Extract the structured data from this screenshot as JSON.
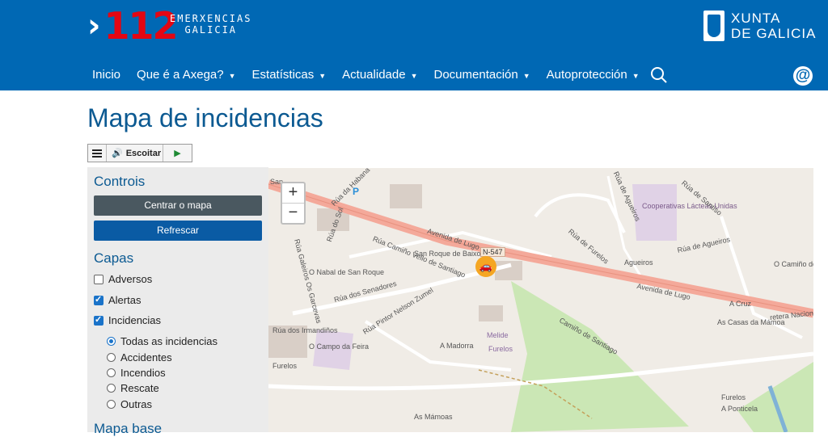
{
  "header": {
    "logo_number": "112",
    "logo_line1": "EMERXENCIAS",
    "logo_line2": "GALICIA",
    "xunta_line1": "XUNTA",
    "xunta_line2": "DE GALICIA",
    "background": "#0068b4"
  },
  "nav": {
    "items": [
      {
        "label": "Inicio",
        "dropdown": false
      },
      {
        "label": "Que é a Axega?",
        "dropdown": true
      },
      {
        "label": "Estatísticas",
        "dropdown": true
      },
      {
        "label": "Actualidade",
        "dropdown": true
      },
      {
        "label": "Documentación",
        "dropdown": true
      },
      {
        "label": "Autoprotección",
        "dropdown": true
      }
    ],
    "search_icon": "search-icon",
    "contact_icon": "at-icon"
  },
  "page": {
    "title": "Mapa de incidencias"
  },
  "player": {
    "menu_icon": "menu-icon",
    "listen_label": "Escoitar",
    "play_icon": "play-icon"
  },
  "sidebar": {
    "controls_heading": "Controis",
    "center_button": "Centrar o mapa",
    "refresh_button": "Refrescar",
    "layers_heading": "Capas",
    "layers": [
      {
        "label": "Adversos",
        "checked": false
      },
      {
        "label": "Alertas",
        "checked": true
      },
      {
        "label": "Incidencias",
        "checked": true
      }
    ],
    "incident_filters": [
      {
        "label": "Todas as incidencias",
        "selected": true
      },
      {
        "label": "Accidentes",
        "selected": false
      },
      {
        "label": "Incendios",
        "selected": false
      },
      {
        "label": "Rescate",
        "selected": false
      },
      {
        "label": "Outras",
        "selected": false
      }
    ],
    "basemap_heading": "Mapa base"
  },
  "map": {
    "zoom_in": "+",
    "zoom_out": "−",
    "road_badge": "N-547",
    "labels": [
      "Avenida de Lugo",
      "Avenida de Lugo",
      "San Roque de Baixo",
      "O Nabal de San Roque",
      "Rúa Camiño Vello de Santiago",
      "Rúa dos Senadores",
      "Rúa Pintor Nelson Zumel",
      "Rúa de Agueiros",
      "Rúa de Furelos",
      "Agueiros",
      "Cooperativas Lácteas Unidas",
      "Rúa de Santiso",
      "Rúa de Agueiros",
      "O Camiño de Agro",
      "A Cruz",
      "retera Naciona",
      "As Casas da Mámoa",
      "Camiño de Santiago",
      "Melide",
      "Furelos",
      "A Madorra",
      "O Campo da Feira",
      "Rúa dos Irmandiños",
      "Rúa Galeiros Os Garcevas",
      "Rúa do Sol",
      "Rúa da Habana",
      "Furelos",
      "Furelos",
      "A Ponticela",
      "As Mámoas",
      "San",
      "P"
    ],
    "colors": {
      "main_road": "#f4a99a",
      "park": "#cbe7b5",
      "coop": "#e0d2e6"
    }
  }
}
